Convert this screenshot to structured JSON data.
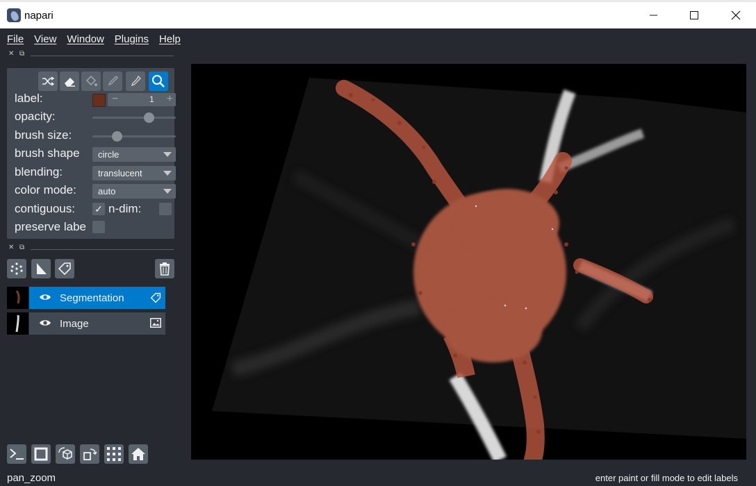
{
  "window": {
    "title": "napari"
  },
  "menu": [
    {
      "label": "File"
    },
    {
      "label": "View"
    },
    {
      "label": "Window"
    },
    {
      "label": "Plugins"
    },
    {
      "label": "Help"
    }
  ],
  "layer_controls": {
    "tools": [
      "shuffle-icon",
      "erase-icon",
      "fill-icon",
      "paint-icon",
      "picker-icon",
      "pan-zoom-icon"
    ],
    "active_tool": "pan-zoom-icon",
    "label": {
      "label": "label:",
      "value": "1",
      "minus": "−",
      "plus": "+",
      "color": "#6a2e1c"
    },
    "opacity": {
      "label": "opacity:",
      "value": 0.7
    },
    "brush_size": {
      "label": "brush size:",
      "value": 0.27
    },
    "brush_shape": {
      "label": "brush shape",
      "value": "circle"
    },
    "blending": {
      "label": "blending:",
      "value": "translucent"
    },
    "color_mode": {
      "label": "color mode:",
      "value": "auto"
    },
    "contiguous": {
      "label": "contiguous:",
      "checked": true,
      "mark": "✓"
    },
    "ndim": {
      "label": "n-dim:",
      "checked": false
    },
    "preserve": {
      "label": "preserve labe",
      "checked": false
    }
  },
  "layers": [
    {
      "name": "Segmentation",
      "selected": true,
      "type": "labels"
    },
    {
      "name": "Image",
      "selected": false,
      "type": "image"
    }
  ],
  "status": {
    "mode": "pan_zoom",
    "hint": "enter paint or fill mode to edit labels"
  },
  "colors": {
    "accent": "#007acc",
    "label_color": "#c4634a"
  }
}
